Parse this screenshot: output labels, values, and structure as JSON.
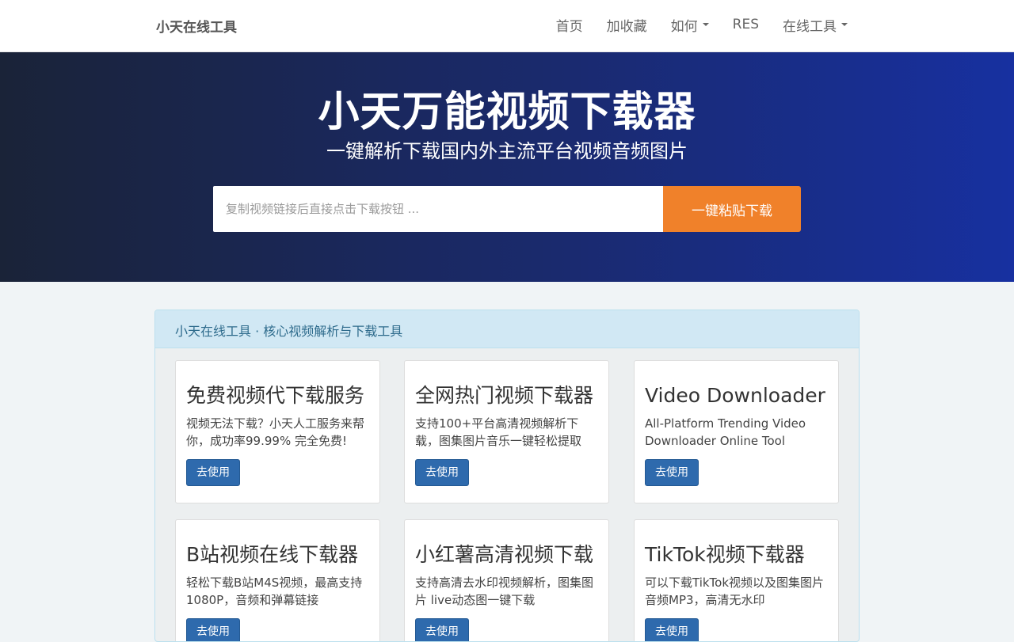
{
  "navbar": {
    "brand": "小天在线工具",
    "items": [
      {
        "label": "首页",
        "dropdown": false
      },
      {
        "label": "加收藏",
        "dropdown": false
      },
      {
        "label": "如何",
        "dropdown": true
      },
      {
        "label": "RES",
        "dropdown": false
      },
      {
        "label": "在线工具",
        "dropdown": true
      }
    ]
  },
  "hero": {
    "title": "小天万能视频下载器",
    "subtitle": "一键解析下载国内外主流平台视频音频图片",
    "search_placeholder": "复制视频链接后直接点击下载按钮 ...",
    "search_value": "",
    "button_label": "一键粘贴下载"
  },
  "panel": {
    "heading": "小天在线工具 · 核心视频解析与下载工具",
    "cards": [
      {
        "title": "免费视频代下载服务",
        "desc": "视频无法下载？小天人工服务来帮你，成功率99.99% 完全免费!",
        "button": "去使用"
      },
      {
        "title": "全网热门视频下载器",
        "desc": "支持100+平台高清视频解析下载，图集图片音乐一键轻松提取",
        "button": "去使用"
      },
      {
        "title": "Video Downloader",
        "desc": "All-Platform Trending Video Downloader Online Tool",
        "button": "去使用"
      },
      {
        "title": "B站视频在线下载器",
        "desc": "轻松下载B站M4S视频，最高支持1080P，音频和弹幕链接",
        "button": "去使用"
      },
      {
        "title": "小红薯高清视频下载",
        "desc": "支持高清去水印视频解析，图集图片 live动态图一键下载",
        "button": "去使用"
      },
      {
        "title": "TikTok视频下载器",
        "desc": "可以下载TikTok视频以及图集图片音频MP3，高清无水印",
        "button": "去使用"
      }
    ]
  },
  "colors": {
    "accent_button": "#f0812a",
    "primary_button": "#2e6aad",
    "hero_gradient_start": "#1a2338",
    "hero_gradient_end": "#1730a0"
  }
}
